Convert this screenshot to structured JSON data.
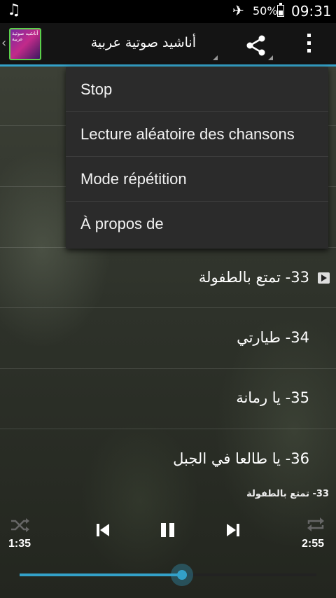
{
  "status_bar": {
    "battery_percent": "50%",
    "time": "09:31"
  },
  "action_bar": {
    "title": "أناشيد صوتية عربية",
    "app_icon_text": "أناشيد صوتية عربية"
  },
  "menu": {
    "items": [
      "Stop",
      "Lecture aléatoire des chansons",
      "Mode répétition",
      "À propos de"
    ]
  },
  "tracks": [
    {
      "label": "33- تمتع بالطفولة",
      "playing": true
    },
    {
      "label": "34- طيارتي",
      "playing": false
    },
    {
      "label": "35- يا رمانة",
      "playing": false
    },
    {
      "label": "36- يا طالعا في الجبل",
      "playing": false
    }
  ],
  "player": {
    "now_playing": "33- تمتع بالطفولة",
    "elapsed": "1:35",
    "duration": "2:55",
    "progress": 0.548
  },
  "colors": {
    "accent": "#33a1c9",
    "app_icon_border": "#5bd04b"
  }
}
